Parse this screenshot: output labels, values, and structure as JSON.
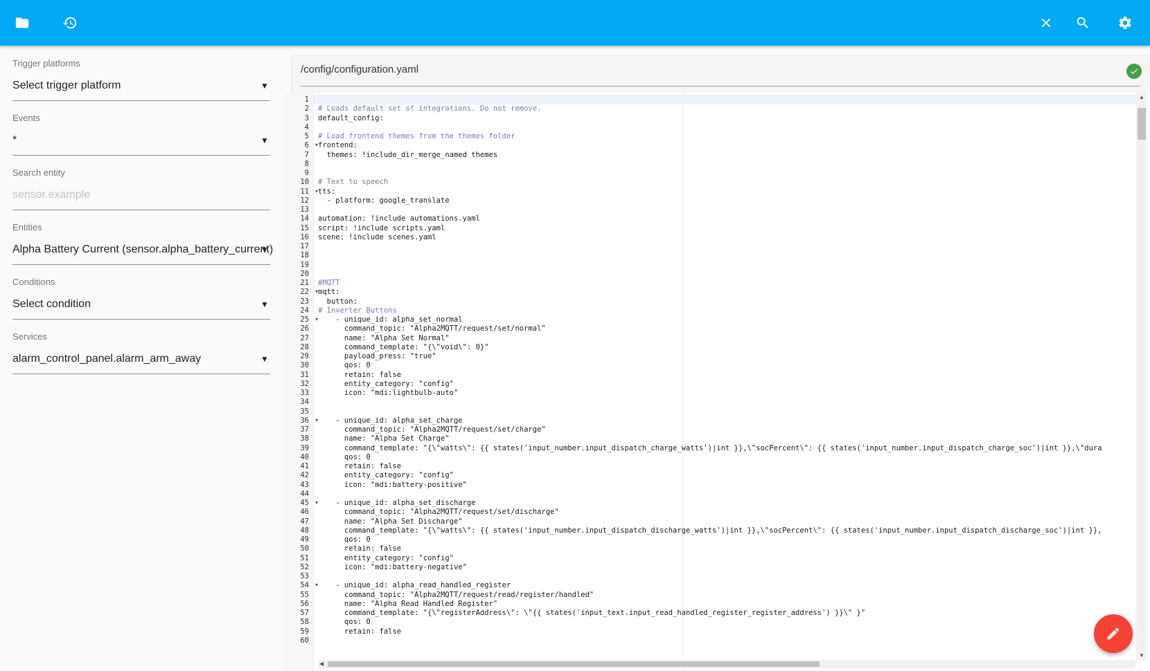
{
  "toolbar": {
    "icons": [
      "folder-icon",
      "history-icon",
      "close-icon",
      "search-icon",
      "gear-icon"
    ],
    "background_color": "#03a9f4"
  },
  "sidebar": {
    "fields": [
      {
        "label": "Trigger platforms",
        "value": "Select trigger platform",
        "placeholder": false
      },
      {
        "label": "Events",
        "value": "*",
        "placeholder": false
      },
      {
        "label": "Search entity",
        "value": "sensor.example",
        "placeholder": true
      },
      {
        "label": "Entities",
        "value": "Alpha Battery Current (sensor.alpha_battery_current)",
        "placeholder": false
      },
      {
        "label": "Conditions",
        "value": "Select condition",
        "placeholder": false
      },
      {
        "label": "Services",
        "value": "alarm_control_panel.alarm_arm_away",
        "placeholder": false
      }
    ]
  },
  "editor": {
    "file_path": "/config/configuration.yaml",
    "status_icon": "check-circle-icon",
    "status_color": "#43a047",
    "lines": [
      "",
      "# Loads default set of integrations. Do not remove.",
      "default_config:",
      "",
      "# Load frontend themes from the themes folder",
      "frontend:",
      "  themes: !include_dir_merge_named themes",
      "",
      "    ",
      "# Text to speech",
      "tts:",
      "  - platform: google_translate",
      "",
      "automation: !include automations.yaml",
      "script: !include scripts.yaml",
      "scene: !include scenes.yaml",
      "",
      "",
      "",
      "",
      "#MQTT",
      "mqtt:",
      "  button:",
      "# Inverter Buttons",
      "    - unique_id: alpha_set_normal",
      "      command_topic: \"Alpha2MQTT/request/set/normal\"",
      "      name: \"Alpha Set Normal\"",
      "      command_template: \"{\\\"void\\\": 0}\"",
      "      payload_press: \"true\"",
      "      qos: 0",
      "      retain: false",
      "      entity_category: \"config\"",
      "      icon: \"mdi:lightbulb-auto\"",
      "",
      "",
      "    - unique_id: alpha_set_charge",
      "      command_topic: \"Alpha2MQTT/request/set/charge\"",
      "      name: \"Alpha Set Charge\"",
      "      command_template: \"{\\\"watts\\\": {{ states('input_number.input_dispatch_charge_watts')|int }},\\\"socPercent\\\": {{ states('input_number.input_dispatch_charge_soc')|int }},\\\"dura",
      "      qos: 0",
      "      retain: false",
      "      entity_category: \"config\"",
      "      icon: \"mdi:battery-positive\"",
      "",
      "    - unique_id: alpha_set_discharge",
      "      command_topic: \"Alpha2MQTT/request/set/discharge\"",
      "      name: \"Alpha Set Discharge\"",
      "      command_template: \"{\\\"watts\\\": {{ states('input_number.input_dispatch_discharge_watts')|int }},\\\"socPercent\\\": {{ states('input_number.input_dispatch_discharge_soc')|int }},",
      "      qos: 0",
      "      retain: false",
      "      entity_category: \"config\"",
      "      icon: \"mdi:battery-negative\"",
      "",
      "    - unique_id: alpha_read_handled_register",
      "      command_topic: \"Alpha2MQTT/request/read/register/handled\"",
      "      name: \"Alpha Read Handled Register\"",
      "      command_template: \"{\\\"registerAddress\\\": \\\"{{ states('input_text.input_read_handled_register_register_address') }}\\\" }\"",
      "      qos: 0",
      "      retain: false",
      ""
    ],
    "fold_lines": [
      6,
      11,
      22,
      25,
      36,
      45,
      54
    ]
  },
  "fab": {
    "icon": "pencil-icon",
    "color": "#f44336"
  }
}
